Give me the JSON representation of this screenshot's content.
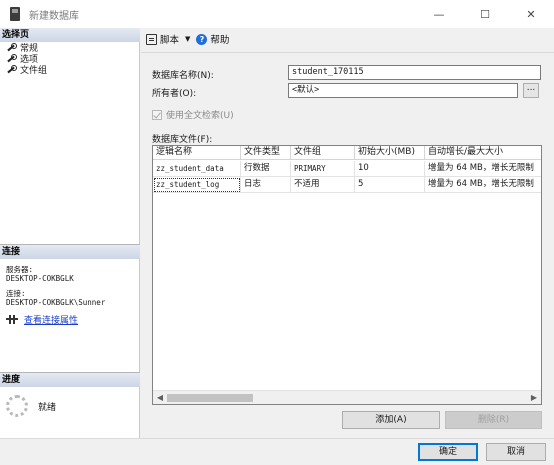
{
  "window": {
    "title": "新建数据库",
    "minimize": "—",
    "maximize": "☐",
    "close": "✕"
  },
  "left_pane": {
    "pages_header": "选择页",
    "pages": [
      {
        "label": "常规"
      },
      {
        "label": "选项"
      },
      {
        "label": "文件组"
      }
    ],
    "connection_header": "连接",
    "server_label": "服务器:",
    "server_value": "DESKTOP-COKBGLK",
    "connection_label": "连接:",
    "connection_value": "DESKTOP-COKBGLK\\Sunner",
    "view_props_link": "查看连接属性",
    "progress_header": "进度",
    "progress_status": "就绪"
  },
  "toolbar": {
    "script_label": "脚本",
    "help_label": "帮助"
  },
  "form": {
    "db_name_label": "数据库名称(N):",
    "db_name_value": "student_170115",
    "owner_label": "所有者(O):",
    "owner_value": "<默认>",
    "browse_label": "...",
    "fulltext_label": "使用全文检索(U)",
    "db_files_label": "数据库文件(F):"
  },
  "files_table": {
    "columns": [
      "逻辑名称",
      "文件类型",
      "文件组",
      "初始大小(MB)",
      "自动增长/最大大小"
    ],
    "rows": [
      [
        "zz_student_data",
        "行数据",
        "PRIMARY",
        "10",
        "增量为 64 MB，增长无限制"
      ],
      [
        "zz_student_log",
        "日志",
        "不适用",
        "5",
        "增量为 64 MB，增长无限制"
      ]
    ]
  },
  "buttons": {
    "add": "添加(A)",
    "remove": "删除(R)",
    "ok": "确定",
    "cancel": "取消"
  }
}
